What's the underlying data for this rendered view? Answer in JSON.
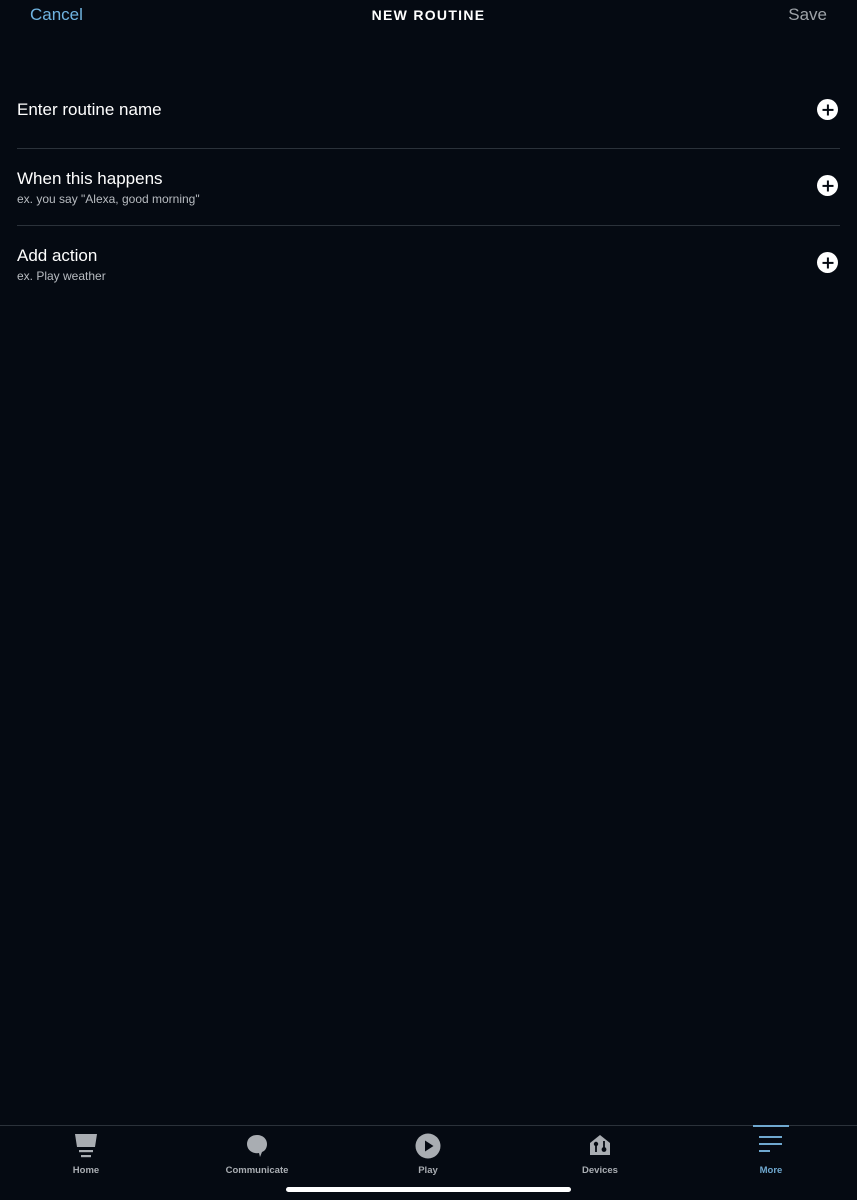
{
  "header": {
    "cancel_label": "Cancel",
    "title": "NEW ROUTINE",
    "save_label": "Save"
  },
  "rows": [
    {
      "title": "Enter routine name",
      "subtitle": "",
      "icon": "plus-circle-icon"
    },
    {
      "title": "When this happens",
      "subtitle": "ex. you say \"Alexa, good morning\"",
      "icon": "plus-circle-icon"
    },
    {
      "title": "Add action",
      "subtitle": "ex. Play weather",
      "icon": "plus-circle-icon"
    }
  ],
  "tabbar": {
    "active": "More",
    "items": [
      {
        "label": "Home",
        "icon": "home-icon"
      },
      {
        "label": "Communicate",
        "icon": "speech-bubble-icon"
      },
      {
        "label": "Play",
        "icon": "play-icon"
      },
      {
        "label": "Devices",
        "icon": "devices-house-icon"
      },
      {
        "label": "More",
        "icon": "menu-lines-icon"
      }
    ]
  },
  "colors": {
    "background": "#050a12",
    "accent": "#6fb3e0",
    "active_tab": "#6fa8cf",
    "inactive_tab": "#a9adb2",
    "divider": "#2b323a"
  }
}
